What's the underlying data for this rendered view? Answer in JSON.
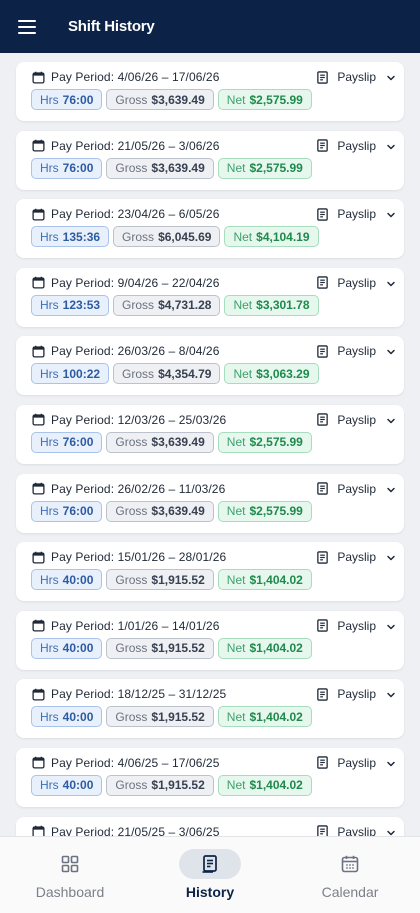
{
  "header": {
    "title": "Shift History"
  },
  "labels": {
    "pay_period_prefix": "Pay Period:",
    "payslip": "Payslip",
    "hrs": "Hrs",
    "gross": "Gross",
    "net": "Net"
  },
  "periods": [
    {
      "range": "4/06/26 – 17/06/26",
      "hrs": "76:00",
      "gross": "$3,639.49",
      "net": "$2,575.99"
    },
    {
      "range": "21/05/26 – 3/06/26",
      "hrs": "76:00",
      "gross": "$3,639.49",
      "net": "$2,575.99"
    },
    {
      "range": "23/04/26 – 6/05/26",
      "hrs": "135:36",
      "gross": "$6,045.69",
      "net": "$4,104.19"
    },
    {
      "range": "9/04/26 – 22/04/26",
      "hrs": "123:53",
      "gross": "$4,731.28",
      "net": "$3,301.78"
    },
    {
      "range": "26/03/26 – 8/04/26",
      "hrs": "100:22",
      "gross": "$4,354.79",
      "net": "$3,063.29"
    },
    {
      "range": "12/03/26 – 25/03/26",
      "hrs": "76:00",
      "gross": "$3,639.49",
      "net": "$2,575.99"
    },
    {
      "range": "26/02/26 – 11/03/26",
      "hrs": "76:00",
      "gross": "$3,639.49",
      "net": "$2,575.99"
    },
    {
      "range": "15/01/26 – 28/01/26",
      "hrs": "40:00",
      "gross": "$1,915.52",
      "net": "$1,404.02"
    },
    {
      "range": "1/01/26 – 14/01/26",
      "hrs": "40:00",
      "gross": "$1,915.52",
      "net": "$1,404.02"
    },
    {
      "range": "18/12/25 – 31/12/25",
      "hrs": "40:00",
      "gross": "$1,915.52",
      "net": "$1,404.02"
    },
    {
      "range": "4/06/25 – 17/06/25",
      "hrs": "40:00",
      "gross": "$1,915.52",
      "net": "$1,404.02"
    },
    {
      "range": "21/05/25 – 3/06/25",
      "hrs": "",
      "gross": "",
      "net": ""
    }
  ],
  "nav": {
    "items": [
      {
        "label": "Dashboard",
        "icon": "grid-icon",
        "active": false
      },
      {
        "label": "History",
        "icon": "receipt-icon",
        "active": true
      },
      {
        "label": "Calendar",
        "icon": "calendar-icon",
        "active": false
      }
    ]
  },
  "colors": {
    "header_bg": "#0c2347",
    "hrs_accent": "#2d5aa0",
    "net_accent": "#1f8a4c",
    "page_bg": "#eef0f4"
  }
}
